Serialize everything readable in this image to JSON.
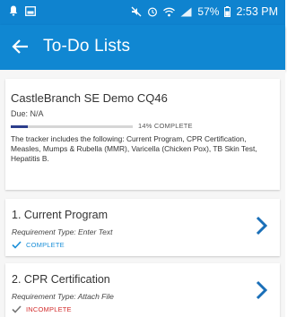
{
  "status_bar": {
    "battery": "57%",
    "time": "2:53 PM"
  },
  "header": {
    "title": "To-Do Lists"
  },
  "tracker": {
    "name": "CastleBranch SE Demo CQ46",
    "due": "Due: N/A",
    "progress_percent": 14,
    "progress_label": "14% COMPLETE",
    "description": "The tracker includes the following: Current Program, CPR Certification, Measles, Mumps & Rubella (MMR), Varicella (Chicken Pox), TB Skin Test, Hepatitis B."
  },
  "requirements": [
    {
      "title": "1. Current Program",
      "type": "Requirement Type: Enter Text",
      "status": "COMPLETE",
      "status_color": "#1A8FD8"
    },
    {
      "title": "2. CPR Certification",
      "type": "Requirement Type: Attach File",
      "status": "INCOMPLETE",
      "status_color": "#D32F2F"
    }
  ],
  "colors": {
    "primary": "#1087D2",
    "status_bar": "#0F83CF",
    "progress": "#2C3E8C",
    "chevron": "#1A6FB8"
  }
}
